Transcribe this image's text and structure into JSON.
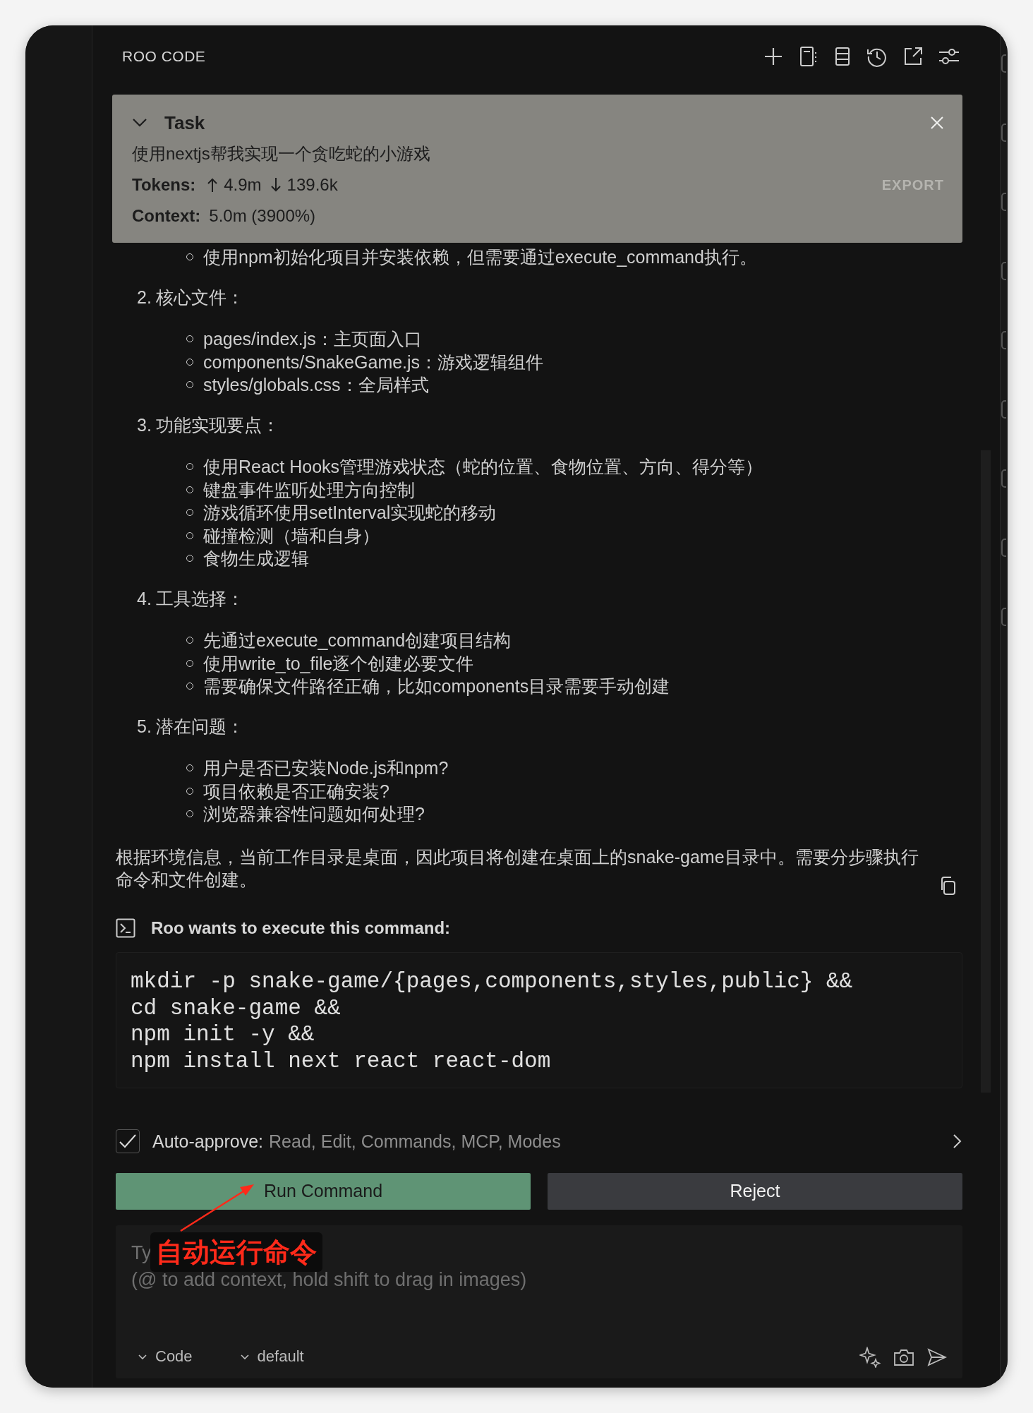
{
  "header": {
    "title": "ROO CODE"
  },
  "task": {
    "label": "Task",
    "expanded": true,
    "text": "使用nextjs帮我实现一个贪吃蛇的小游戏",
    "tokens_label": "Tokens:",
    "tokens_up": "4.9m",
    "tokens_down": "139.6k",
    "export": "EXPORT",
    "context_label": "Context:",
    "context": "5.0m (3900%)"
  },
  "message": {
    "partial_item": "使用npm初始化项目并安装依赖，但需要通过execute_command执行。",
    "sections": [
      {
        "number": "2.",
        "title": "核心文件：",
        "items": [
          "pages/index.js：主页面入口",
          "components/SnakeGame.js：游戏逻辑组件",
          "styles/globals.css：全局样式"
        ]
      },
      {
        "number": "3.",
        "title": "功能实现要点：",
        "items": [
          "使用React Hooks管理游戏状态（蛇的位置、食物位置、方向、得分等）",
          "键盘事件监听处理方向控制",
          "游戏循环使用setInterval实现蛇的移动",
          "碰撞检测（墙和自身）",
          "食物生成逻辑"
        ]
      },
      {
        "number": "4.",
        "title": "工具选择：",
        "items": [
          "先通过execute_command创建项目结构",
          "使用write_to_file逐个创建必要文件",
          "需要确保文件路径正确，比如components目录需要手动创建"
        ]
      },
      {
        "number": "5.",
        "title": "潜在问题：",
        "items": [
          "用户是否已安装Node.js和npm?",
          "项目依赖是否正确安装?",
          "浏览器兼容性问题如何处理?"
        ]
      }
    ],
    "paragraph": "根据环境信息，当前工作目录是桌面，因此项目将创建在桌面上的snake-game目录中。需要分步骤执行命令和文件创建。"
  },
  "command": {
    "title": "Roo wants to execute this command:",
    "lines": [
      "mkdir -p snake-game/{pages,components,styles,public} &&",
      "cd snake-game &&",
      "npm init -y &&",
      "npm install next react react-dom"
    ]
  },
  "auto_approve": {
    "checked": true,
    "label": "Auto-approve:",
    "value": "Read, Edit, Commands, MCP, Modes"
  },
  "buttons": [
    {
      "label": "Run Command",
      "kind": "primary"
    },
    {
      "label": "Reject",
      "kind": "secondary"
    }
  ],
  "input": {
    "placeholder": "Ty\n(@ to add context, hold shift to drag in images)",
    "mode": "Code",
    "profile": "default"
  },
  "annotation": {
    "text": "自动运行命令"
  }
}
